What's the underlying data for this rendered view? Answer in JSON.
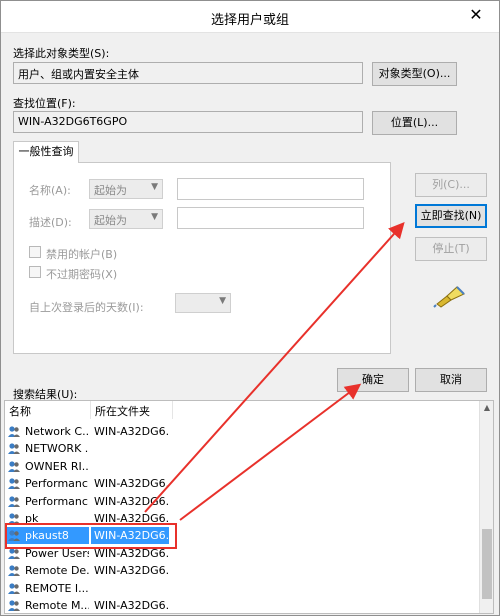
{
  "window": {
    "title": "选择用户或组",
    "close_glyph": "✕"
  },
  "object_type": {
    "label": "选择此对象类型(S):",
    "value": "用户、组或内置安全主体",
    "button": "对象类型(O)..."
  },
  "location": {
    "label": "查找位置(F):",
    "value": "WIN-A32DG6T6GPO",
    "button": "位置(L)..."
  },
  "query": {
    "tab": "一般性查询",
    "name_label": "名称(A):",
    "name_op": "起始为",
    "desc_label": "描述(D):",
    "desc_op": "起始为",
    "disabled_accounts": "禁用的帐户(B)",
    "non_expiring_pw": "不过期密码(X)",
    "days_since_login": "自上次登录后的天数(I):"
  },
  "side_buttons": {
    "columns": "列(C)...",
    "find_now": "立即查找(N)",
    "stop": "停止(T)"
  },
  "dialog_buttons": {
    "ok": "确定",
    "cancel": "取消"
  },
  "results": {
    "label": "搜索结果(U):",
    "columns": [
      "名称",
      "所在文件夹"
    ],
    "rows": [
      {
        "name": "Network C...",
        "folder": "WIN-A32DG6..."
      },
      {
        "name": "NETWORK ...",
        "folder": ""
      },
      {
        "name": "OWNER RI...",
        "folder": ""
      },
      {
        "name": "Performanc...",
        "folder": "WIN-A32DG6..."
      },
      {
        "name": "Performanc...",
        "folder": "WIN-A32DG6..."
      },
      {
        "name": "pk",
        "folder": "WIN-A32DG6..."
      },
      {
        "name": "pkaust8",
        "folder": "WIN-A32DG6...",
        "selected": true
      },
      {
        "name": "Power Users",
        "folder": "WIN-A32DG6..."
      },
      {
        "name": "Remote De...",
        "folder": "WIN-A32DG6..."
      },
      {
        "name": "REMOTE I...",
        "folder": ""
      },
      {
        "name": "Remote M...",
        "folder": "WIN-A32DG6..."
      }
    ]
  },
  "colors": {
    "annotation_red": "#e8312b",
    "selection_blue": "#3399ff"
  }
}
